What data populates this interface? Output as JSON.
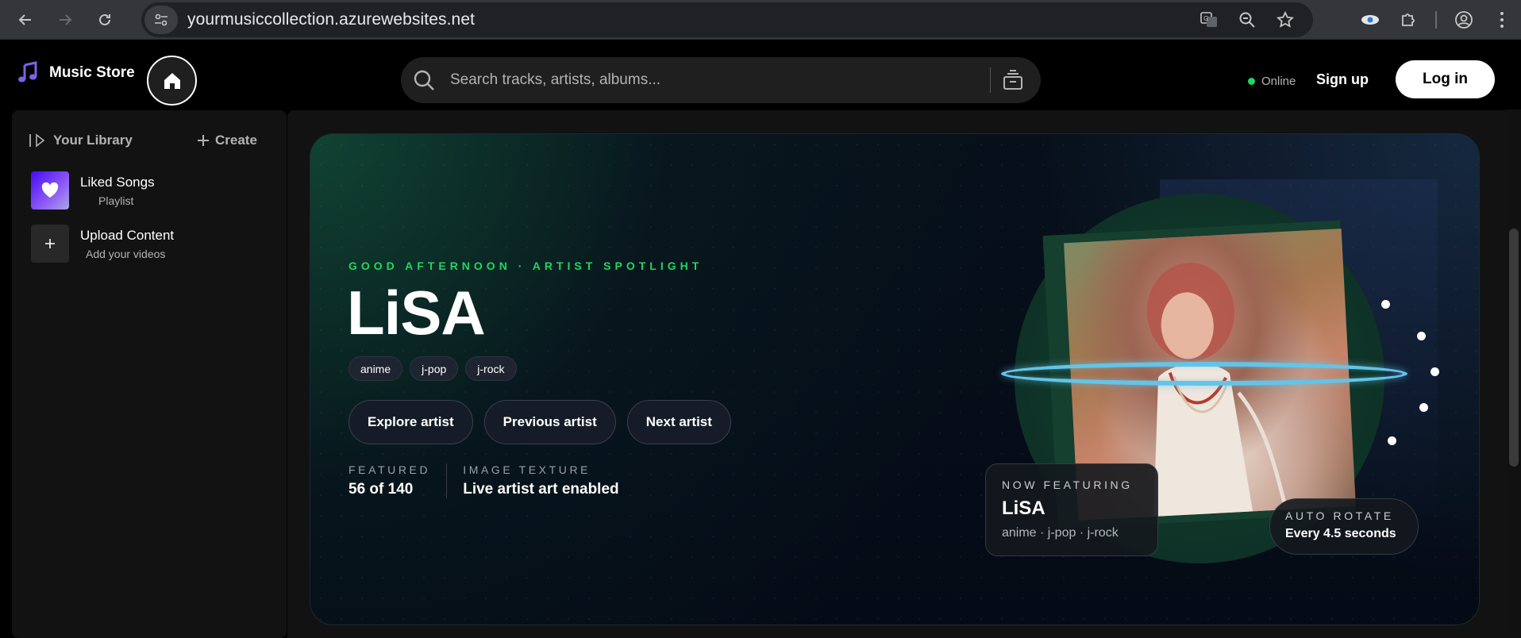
{
  "browser": {
    "url": "yourmusiccollection.azurewebsites.net"
  },
  "header": {
    "app_title": "Music Store",
    "search_placeholder": "Search tracks, artists, albums...",
    "status": "Online",
    "signup": "Sign up",
    "login": "Log in"
  },
  "sidebar": {
    "library_label": "Your Library",
    "create_label": "Create",
    "items": [
      {
        "title": "Liked Songs",
        "subtitle": "Playlist"
      },
      {
        "title": "Upload Content",
        "subtitle": "Add your videos"
      }
    ]
  },
  "hero": {
    "eyebrow": "GOOD AFTERNOON · ARTIST SPOTLIGHT",
    "artist": "LiSA",
    "tags": [
      "anime",
      "j-pop",
      "j-rock"
    ],
    "actions": [
      "Explore artist",
      "Previous artist",
      "Next artist"
    ],
    "stats": [
      {
        "label": "FEATURED",
        "value": "56 of 140"
      },
      {
        "label": "IMAGE TEXTURE",
        "value": "Live artist art enabled"
      }
    ],
    "now_featuring": {
      "label": "NOW FEATURING",
      "name": "LiSA",
      "tags": "anime · j-pop · j-rock"
    },
    "auto_rotate": {
      "label": "AUTO ROTATE",
      "value": "Every 4.5 seconds"
    }
  },
  "colors": {
    "accent": "#1ed760",
    "ring": "#63c4e8",
    "liked_thumb": "#6b3cf2"
  }
}
